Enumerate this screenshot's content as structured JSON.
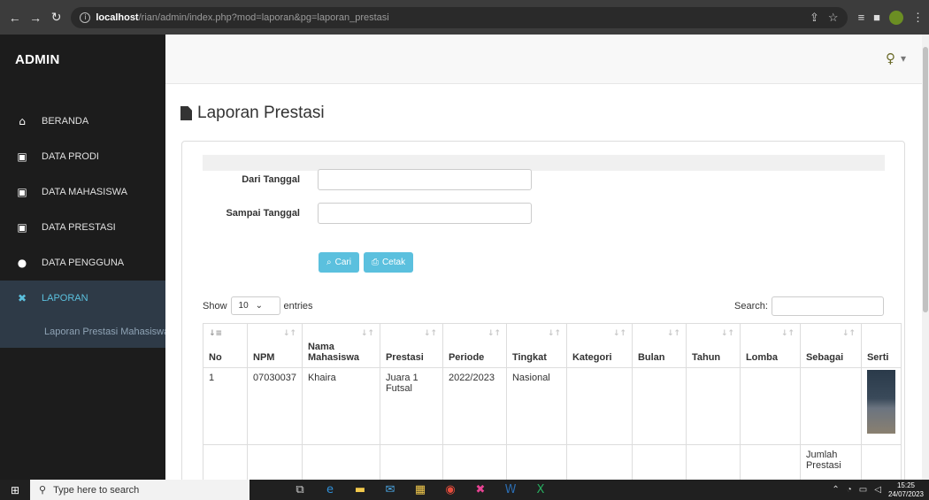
{
  "browser": {
    "url_host": "localhost",
    "url_path": "/rian/admin/index.php?mod=laporan&pg=laporan_prestasi"
  },
  "sidebar": {
    "brand": "ADMIN",
    "items": [
      {
        "label": "BERANDA",
        "icon": "home-icon"
      },
      {
        "label": "DATA PRODI",
        "icon": "calendar-icon"
      },
      {
        "label": "DATA MAHASISWA",
        "icon": "calendar-icon"
      },
      {
        "label": "DATA PRESTASI",
        "icon": "calendar-icon"
      },
      {
        "label": "DATA PENGGUNA",
        "icon": "user-icon"
      },
      {
        "label": "LAPORAN",
        "icon": "wrench-icon"
      }
    ],
    "submenu": "Laporan Prestasi Mahasiswa"
  },
  "header": {
    "user_caret": "▾"
  },
  "page": {
    "title": "Laporan Prestasi"
  },
  "form": {
    "from_label": "Dari Tanggal",
    "to_label": "Sampai Tanggal",
    "search_button": "Cari",
    "print_button": "Cetak"
  },
  "datatable": {
    "show_label": "Show",
    "entries_value": "10",
    "entries_label": "entries",
    "search_label": "Search:"
  },
  "table": {
    "columns": [
      "No",
      "NPM",
      "Nama Mahasiswa",
      "Prestasi",
      "Periode",
      "Tingkat",
      "Kategori",
      "Bulan",
      "Tahun",
      "Lomba",
      "Sebagai",
      "Serti"
    ],
    "rows": [
      {
        "no": "1",
        "npm": "07030037",
        "nama": "Khaira",
        "prestasi": "Juara 1 Futsal",
        "periode": "2022/2023",
        "tingkat": "Nasional",
        "kategori": "",
        "bulan": "",
        "tahun": "",
        "lomba": "",
        "sebagai": ""
      }
    ],
    "total_label": "Jumlah Prestasi"
  },
  "taskbar": {
    "search_placeholder": "Type here to search",
    "time": "15:25",
    "date": "24/07/2023"
  },
  "colors": {
    "sidebar_bg": "#1c1c1c",
    "accent": "#5bc0de",
    "active_bg": "#2e3a47"
  }
}
